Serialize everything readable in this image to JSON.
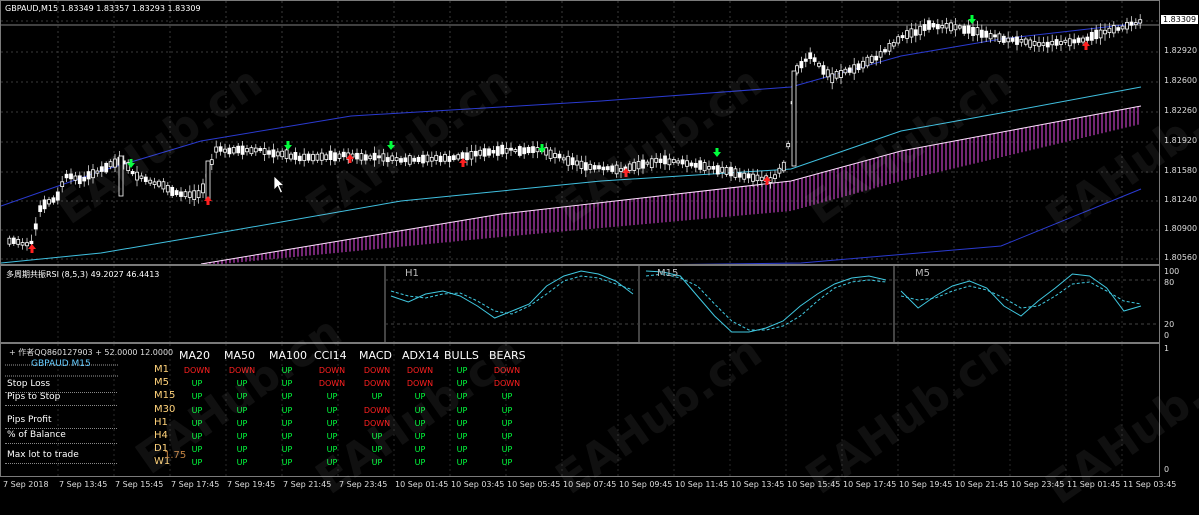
{
  "main": {
    "symbol_label": "GBPAUD,M15  1.83349 1.83357 1.83293 1.83309",
    "price_labels": [
      "1.83309",
      "1.82920",
      "1.82600",
      "1.82260",
      "1.81920",
      "1.81580",
      "1.81240",
      "1.80900",
      "1.80560"
    ],
    "current_price_tag": "1.83309"
  },
  "rsi_pane": {
    "title": "多周期共振RSI (8,5,3) 49.2027 46.4413",
    "timeframes": [
      "H1",
      "M15",
      "M5"
    ],
    "axis_labels": [
      "100",
      "80",
      "20",
      "0"
    ]
  },
  "indicator_pane": {
    "header_text": "+ 作者QQ860127903 + 52.0000 12.0000",
    "symbol_text": "GBPAUD  M15",
    "side_items": [
      "Stop Loss",
      "Pips to Stop",
      "Pips Profit",
      "% of Balance",
      "Max lot to trade"
    ],
    "overlay_value": "1.75",
    "axis_labels": [
      "1",
      "0"
    ],
    "columns": [
      "MA20",
      "MA50",
      "MA100",
      "CCI14",
      "MACD",
      "ADX14",
      "BULLS",
      "BEARS"
    ],
    "rows": [
      {
        "tf": "M1",
        "cells": [
          "DOWN",
          "DOWN",
          "UP",
          "DOWN",
          "DOWN",
          "DOWN",
          "UP",
          "DOWN"
        ]
      },
      {
        "tf": "M5",
        "cells": [
          "UP",
          "UP",
          "UP",
          "DOWN",
          "DOWN",
          "DOWN",
          "UP",
          "DOWN"
        ]
      },
      {
        "tf": "M15",
        "cells": [
          "UP",
          "UP",
          "UP",
          "UP",
          "UP",
          "UP",
          "UP",
          "UP"
        ]
      },
      {
        "tf": "M30",
        "cells": [
          "UP",
          "UP",
          "UP",
          "UP",
          "DOWN",
          "UP",
          "UP",
          "UP"
        ]
      },
      {
        "tf": "H1",
        "cells": [
          "UP",
          "UP",
          "UP",
          "UP",
          "DOWN",
          "UP",
          "UP",
          "UP"
        ]
      },
      {
        "tf": "H4",
        "cells": [
          "UP",
          "UP",
          "UP",
          "UP",
          "UP",
          "UP",
          "UP",
          "UP"
        ]
      },
      {
        "tf": "D1",
        "cells": [
          "UP",
          "UP",
          "UP",
          "UP",
          "UP",
          "UP",
          "UP",
          "UP"
        ]
      },
      {
        "tf": "W1",
        "cells": [
          "UP",
          "UP",
          "UP",
          "UP",
          "UP",
          "UP",
          "UP",
          "UP"
        ]
      }
    ]
  },
  "time_labels": [
    "7 Sep 2018",
    "7 Sep 13:45",
    "7 Sep 15:45",
    "7 Sep 17:45",
    "7 Sep 19:45",
    "7 Sep 21:45",
    "7 Sep 23:45",
    "10 Sep 01:45",
    "10 Sep 03:45",
    "10 Sep 05:45",
    "10 Sep 07:45",
    "10 Sep 09:45",
    "10 Sep 11:45",
    "10 Sep 13:45",
    "10 Sep 15:45",
    "10 Sep 17:45",
    "10 Sep 19:45",
    "10 Sep 21:45",
    "10 Sep 23:45",
    "11 Sep 01:45",
    "11 Sep 03:45"
  ],
  "watermark": "EAHub.cn",
  "colors": {
    "up": "#00ff3c",
    "down": "#ff2020",
    "band": "#c040c0",
    "ma_outer": "#2a3ad0",
    "ma_inner": "#40c0e0"
  }
}
